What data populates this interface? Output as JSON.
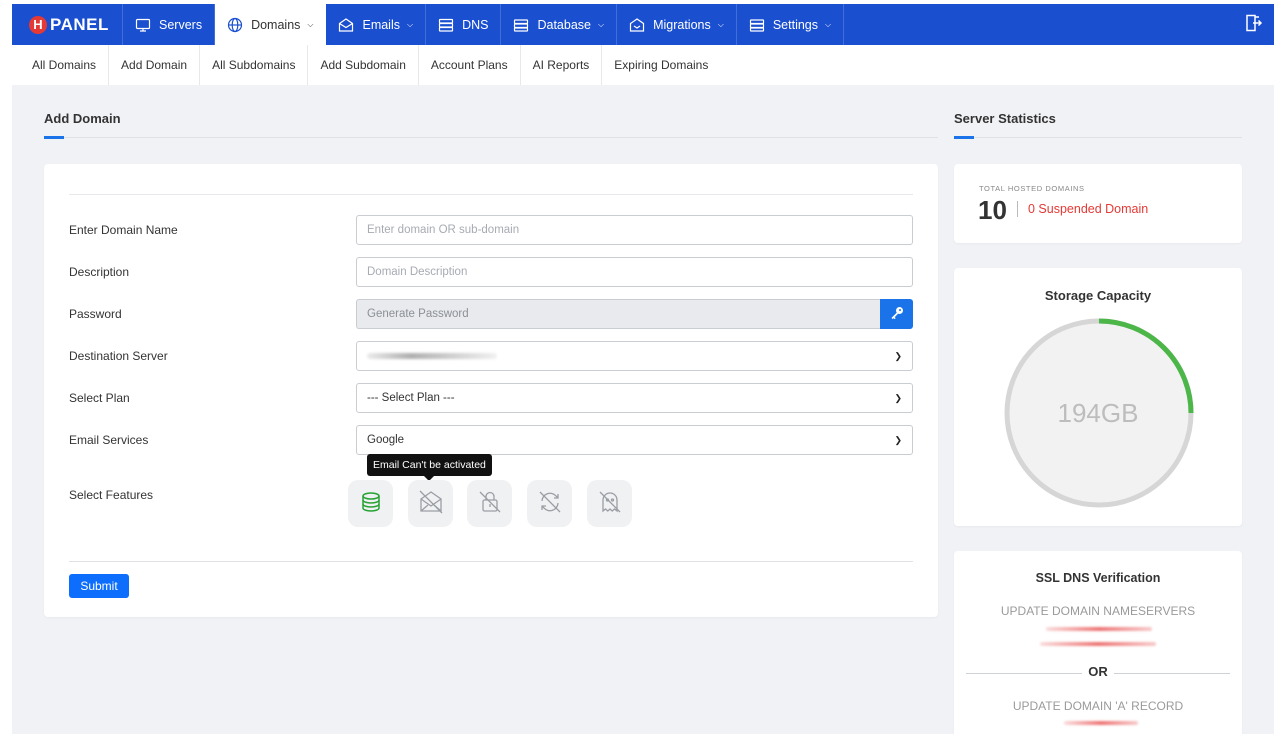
{
  "brand": {
    "badge": "H",
    "name": "PANEL"
  },
  "nav": {
    "items": [
      {
        "label": "Servers",
        "icon": "monitor-icon",
        "dropdown": false
      },
      {
        "label": "Domains",
        "icon": "globe-icon",
        "dropdown": true,
        "active": true
      },
      {
        "label": "Emails",
        "icon": "envelope-icon",
        "dropdown": true
      },
      {
        "label": "DNS",
        "icon": "server-stack-icon",
        "dropdown": false
      },
      {
        "label": "Database",
        "icon": "database-icon",
        "dropdown": true
      },
      {
        "label": "Migrations",
        "icon": "migration-icon",
        "dropdown": true
      },
      {
        "label": "Settings",
        "icon": "settings-icon",
        "dropdown": true
      }
    ],
    "logout_icon": "logout-icon"
  },
  "subnav": {
    "items": [
      "All Domains",
      "Add Domain",
      "All Subdomains",
      "Add Subdomain",
      "Account Plans",
      "AI Reports",
      "Expiring Domains"
    ]
  },
  "add_domain": {
    "title": "Add Domain",
    "fields": {
      "domain": {
        "label": "Enter Domain Name",
        "placeholder": "Enter domain OR sub-domain"
      },
      "description": {
        "label": "Description",
        "placeholder": "Domain Description"
      },
      "password": {
        "label": "Password",
        "placeholder": "Generate Password"
      },
      "destination": {
        "label": "Destination Server"
      },
      "plan": {
        "label": "Select Plan",
        "value": "--- Select Plan ---"
      },
      "email": {
        "label": "Email Services",
        "value": "Google"
      },
      "features": {
        "label": "Select Features"
      }
    },
    "tooltip": "Email Can't be activated",
    "submit_label": "Submit"
  },
  "stats": {
    "title": "Server Statistics",
    "total_label": "TOTAL HOSTED DOMAINS",
    "total_value": "10",
    "suspended": "0 Suspended Domain"
  },
  "storage": {
    "title": "Storage Capacity",
    "value": "194GB",
    "used_fraction": 0.25,
    "colors": {
      "used": "#4cb648",
      "track": "#d6d6d6",
      "accent": "#1a73e8",
      "danger": "#e53935"
    }
  },
  "ssl": {
    "title": "SSL DNS Verification",
    "nameservers_label": "UPDATE DOMAIN NAMESERVERS",
    "or": "OR",
    "a_record_label": "UPDATE DOMAIN 'A' RECORD"
  }
}
